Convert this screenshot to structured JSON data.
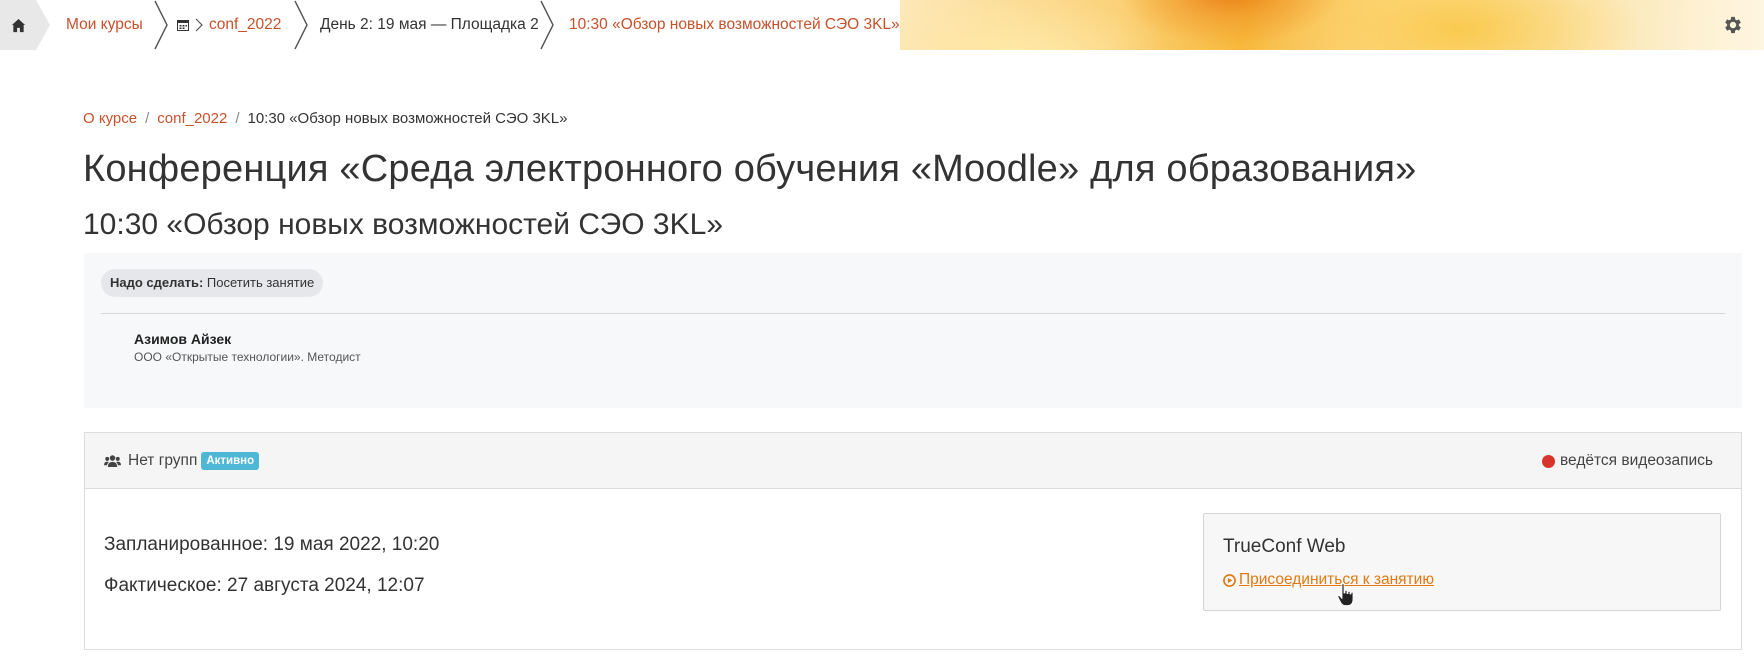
{
  "navbar": {
    "home_icon": "home-icon",
    "crumbs": [
      {
        "label": "Мои курсы"
      },
      {
        "label": "conf_2022",
        "icon": "calendar-icon"
      },
      {
        "label": "День 2: 19 мая — Площадка 2"
      },
      {
        "label": "10:30 «Обзор новых возможностей СЭО 3KL»"
      }
    ],
    "settings_icon": "gear-icon"
  },
  "breadcrumb": {
    "items": [
      "О курсе",
      "conf_2022",
      "10:30 «Обзор новых возможностей СЭО 3KL»"
    ],
    "separator": "/"
  },
  "page": {
    "course_title": "Конференция «Среда электронного обучения «Moodle» для образования»",
    "activity_title": "10:30 «Обзор новых возможностей СЭО 3KL»"
  },
  "info": {
    "todo_label": "Надо сделать:",
    "todo_value": " Посетить занятие",
    "speaker_name": "Азимов Айзек",
    "speaker_role": "ООО «Открытые технологии». Методист"
  },
  "meeting": {
    "groups_label": "Нет групп",
    "status_badge": "Активно",
    "recording_label": "ведётся видеозапись",
    "scheduled": "Запланированное: 19 мая 2022, 10:20",
    "actual": "Фактическое: 27 августа 2024, 12:07",
    "provider_title": "TrueConf Web",
    "join_link": " Присоединиться к занятию"
  },
  "colors": {
    "link": "#c8502a",
    "join_link": "#e07a10",
    "badge": "#4fb7d6",
    "record_dot": "#d9342b"
  }
}
